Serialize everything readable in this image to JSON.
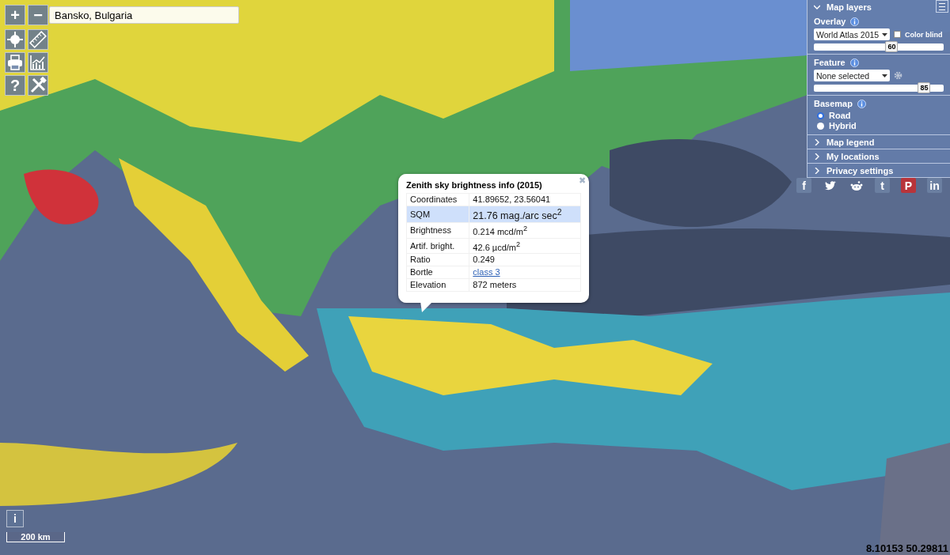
{
  "map_controls": {
    "zoom_in": "+",
    "zoom_out": "−",
    "tools": [
      {
        "kind": "locate"
      },
      {
        "kind": "ruler"
      },
      {
        "kind": "print"
      },
      {
        "kind": "chart"
      },
      {
        "kind": "help",
        "glyph": "?"
      },
      {
        "kind": "tools"
      }
    ]
  },
  "search": {
    "value": "Bansko, Bulgaria"
  },
  "panel": {
    "sections": [
      {
        "title": "Map layers",
        "expanded": true
      },
      {
        "title": "Map legend",
        "expanded": false
      },
      {
        "title": "My locations",
        "expanded": false
      },
      {
        "title": "Privacy settings",
        "expanded": false
      }
    ],
    "overlay": {
      "label": "Overlay",
      "select": "World Atlas 2015",
      "checkbox": {
        "label": "Color blind",
        "checked": false
      },
      "slider": {
        "reading": "60",
        "level": 0.6
      }
    },
    "feature": {
      "label": "Feature",
      "select": "None selected",
      "slider": {
        "reading": "85",
        "level": 0.85
      }
    },
    "basemap": {
      "label": "Basemap",
      "options": [
        {
          "label": "Road",
          "selected": true
        },
        {
          "label": "Hybrid",
          "selected": false
        }
      ]
    }
  },
  "social": [
    {
      "kind": "facebook",
      "glyph": "f"
    },
    {
      "kind": "twitter"
    },
    {
      "kind": "reddit"
    },
    {
      "kind": "tumblr",
      "glyph": "t"
    },
    {
      "kind": "pinterest",
      "glyph": "P"
    },
    {
      "kind": "linkedin",
      "glyph": "in"
    }
  ],
  "popup": {
    "title": "Zenith sky brightness info (2015)",
    "close": "✖",
    "rows": [
      {
        "label": "Coordinates",
        "value": "41.89652, 23.56041",
        "selected": false
      },
      {
        "label": "SQM",
        "value": "21.76 mag./arc sec$^{2}$",
        "selected": true
      },
      {
        "label": "Brightness",
        "value": "0.214 mcd/m$^{2}$",
        "selected": false
      },
      {
        "label": "Artif. bright.",
        "value": "42.6 µcd/m$^{2}$",
        "selected": false
      },
      {
        "label": "Ratio",
        "value": "0.249",
        "selected": false
      },
      {
        "label": "Bortle",
        "value": "class 3",
        "kind": "link",
        "selected": false
      },
      {
        "label": "Elevation",
        "value": "872 meters",
        "selected": false
      }
    ]
  },
  "info_button": "i",
  "scale": "200 km",
  "coordinates": "8.10153 50.29811"
}
